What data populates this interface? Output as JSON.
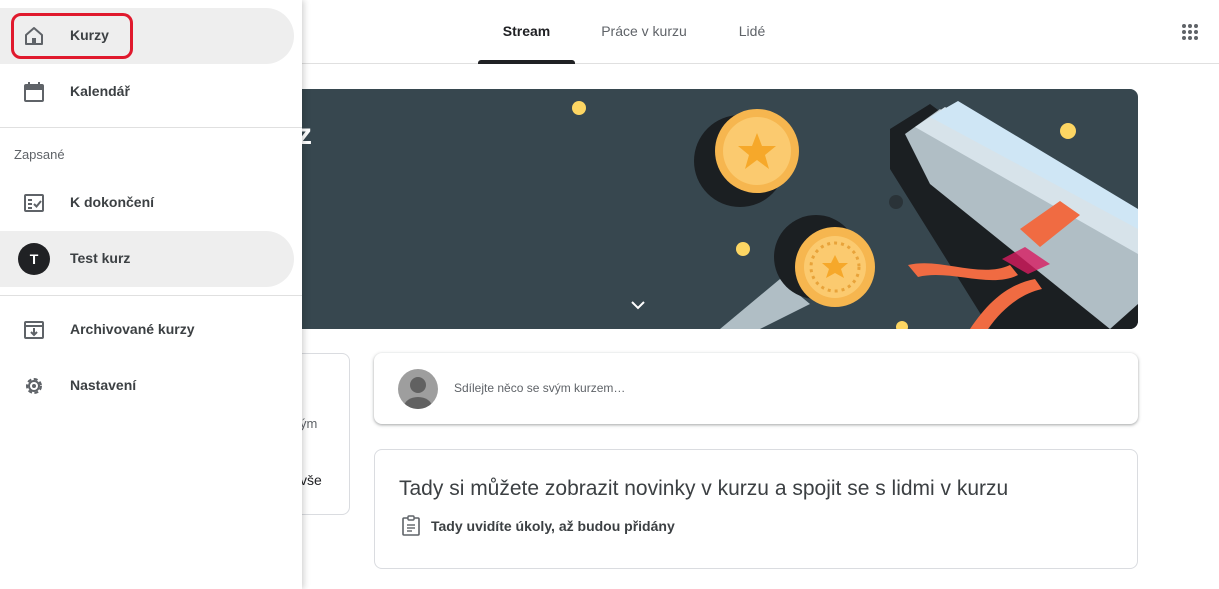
{
  "tabs": [
    {
      "label": "Stream"
    },
    {
      "label": "Práce v kurzu"
    },
    {
      "label": "Lidé"
    }
  ],
  "banner": {
    "title_fragment": "z"
  },
  "upcoming": {
    "text1": "ým",
    "text2": "vše"
  },
  "share": {
    "placeholder": "Sdílejte něco se svým kurzem…"
  },
  "info": {
    "title": "Tady si můžete zobrazit novinky v kurzu a spojit se s lidmi v kurzu",
    "subtitle": "Tady uvidíte úkoly, až budou přidány"
  },
  "drawer": {
    "items_top": [
      {
        "label": "Kurzy",
        "icon": "home-icon"
      },
      {
        "label": "Kalendář",
        "icon": "calendar-icon"
      }
    ],
    "section_label": "Zapsané",
    "items_enrolled": [
      {
        "label": "K dokončení",
        "icon": "todo-list-icon"
      },
      {
        "label": "Test kurz",
        "avatar_letter": "T"
      }
    ],
    "items_bottom": [
      {
        "label": "Archivované kurzy",
        "icon": "archive-icon"
      },
      {
        "label": "Nastavení",
        "icon": "gear-icon"
      }
    ]
  },
  "colors": {
    "banner_bg": "#37474f",
    "coin": "#fdd663",
    "highlight": "#e0192d"
  }
}
